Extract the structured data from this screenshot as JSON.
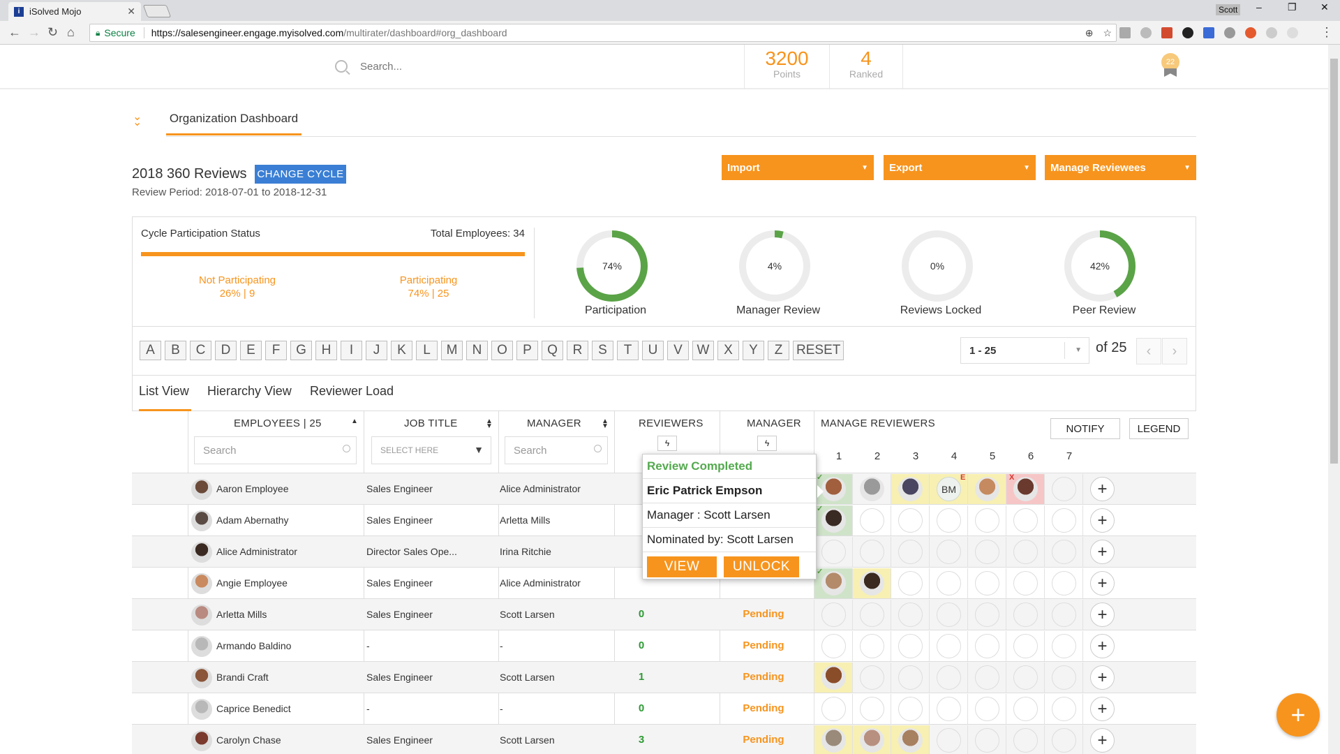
{
  "browser": {
    "tab_title": "iSolved Mojo",
    "tab_close": "✕",
    "user": "Scott",
    "secure_label": "Secure",
    "url_host": "https://salesengineer.engage.myisolved.com",
    "url_path": "/multirater/dashboard#org_dashboard"
  },
  "header": {
    "search_placeholder": "Search...",
    "points_value": "3200",
    "points_label": "Points",
    "ranked_value": "4",
    "ranked_label": "Ranked",
    "badge_count": "22"
  },
  "page": {
    "tab_label": "Organization Dashboard",
    "cycle_title": "2018 360 Reviews",
    "change_cycle_label": "CHANGE CYCLE",
    "review_period": "Review Period: 2018-07-01 to 2018-12-31",
    "import_label": "Import",
    "export_label": "Export",
    "manage_reviewees_label": "Manage Reviewees"
  },
  "participation": {
    "title": "Cycle Participation Status",
    "total": "Total Employees: 34",
    "not_label": "Not Participating",
    "not_value": "26% | 9",
    "yes_label": "Participating",
    "yes_value": "74% | 25"
  },
  "donuts": [
    {
      "label": "Participation",
      "text": "74%",
      "value": 74
    },
    {
      "label": "Manager Review",
      "text": "4%",
      "value": 4
    },
    {
      "label": "Reviews Locked",
      "text": "0%",
      "value": 0
    },
    {
      "label": "Peer Review",
      "text": "42%",
      "value": 42
    }
  ],
  "alphabet": [
    "A",
    "B",
    "C",
    "D",
    "E",
    "F",
    "G",
    "H",
    "I",
    "J",
    "K",
    "L",
    "M",
    "N",
    "O",
    "P",
    "Q",
    "R",
    "S",
    "T",
    "U",
    "V",
    "W",
    "X",
    "Y",
    "Z",
    "RESET"
  ],
  "pagination": {
    "range": "1 - 25",
    "of_label": "of 25",
    "prev": "‹",
    "next": "›"
  },
  "view_tabs": {
    "list": "List View",
    "hierarchy": "Hierarchy View",
    "load": "Reviewer Load"
  },
  "table": {
    "employees_header": "EMPLOYEES | 25",
    "jobtitle_header": "JOB TITLE",
    "manager_header": "MANAGER",
    "reviewers_header": "REVIEWERS",
    "manager2_header": "MANAGER",
    "manage_reviewers_header": "MANAGE REVIEWERS",
    "notify_label": "NOTIFY",
    "legend_label": "LEGEND",
    "emp_search_placeholder": "Search",
    "job_select_placeholder": "SELECT HERE",
    "mgr_search_placeholder": "Search",
    "bolt": "ϟ",
    "slot_numbers": [
      "1",
      "2",
      "3",
      "4",
      "5",
      "6",
      "7"
    ],
    "plus": "+",
    "rows": [
      {
        "name": "Aaron Employee",
        "job": "Sales Engineer",
        "manager": "Alice Administrator",
        "count": "",
        "status": ""
      },
      {
        "name": "Adam Abernathy",
        "job": "Sales Engineer",
        "manager": "Arletta Mills",
        "count": "",
        "status": ""
      },
      {
        "name": "Alice Administrator",
        "job": "Director Sales Ope...",
        "manager": "Irina Ritchie",
        "count": "",
        "status": ""
      },
      {
        "name": "Angie Employee",
        "job": "Sales Engineer",
        "manager": "Alice Administrator",
        "count": "",
        "status": ""
      },
      {
        "name": "Arletta Mills",
        "job": "Sales Engineer",
        "manager": "Scott Larsen",
        "count": "0",
        "status": "Pending"
      },
      {
        "name": "Armando Baldino",
        "job": "-",
        "manager": "-",
        "count": "0",
        "status": "Pending"
      },
      {
        "name": "Brandi Craft",
        "job": "Sales Engineer",
        "manager": "Scott Larsen",
        "count": "1",
        "status": "Pending"
      },
      {
        "name": "Caprice Benedict",
        "job": "-",
        "manager": "-",
        "count": "0",
        "status": "Pending"
      },
      {
        "name": "Carolyn Chase",
        "job": "Sales Engineer",
        "manager": "Scott Larsen",
        "count": "3",
        "status": "Pending"
      }
    ],
    "initials_bm": "BM",
    "mark_e": "E",
    "mark_x": "X",
    "mark_check": "✓"
  },
  "popup": {
    "status": "Review Completed",
    "reviewer": "Eric Patrick Empson",
    "manager": "Manager : Scott Larsen",
    "nominated": "Nominated by: Scott Larsen",
    "view_label": "VIEW",
    "unlock_label": "UNLOCK"
  },
  "fab_label": "+",
  "colors": {
    "accent": "#f7941d",
    "green": "#5aa347",
    "blue": "#3a7fd5"
  }
}
